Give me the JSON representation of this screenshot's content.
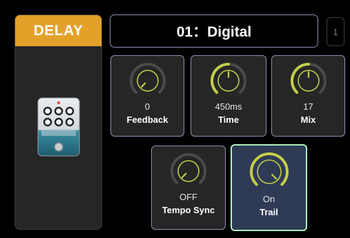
{
  "effect": {
    "title": "DELAY"
  },
  "preset": {
    "name": "01：Digital",
    "page": "1"
  },
  "colors": {
    "accent": "#e3a12a",
    "knob_ring": "#c3cd4a",
    "knob_track": "#4a4a4a",
    "active_card": "#2f3b55",
    "active_border": "#aef0c4"
  },
  "knobs": [
    {
      "label": "Feedback",
      "value": "0",
      "fraction": 0.0
    },
    {
      "label": "Time",
      "value": "450ms",
      "fraction": 0.5
    },
    {
      "label": "Mix",
      "value": "17",
      "fraction": 0.5
    },
    {
      "label": "Tempo Sync",
      "value": "OFF",
      "fraction": 0.0
    },
    {
      "label": "Trail",
      "value": "On",
      "fraction": 1.0,
      "active": true
    }
  ]
}
